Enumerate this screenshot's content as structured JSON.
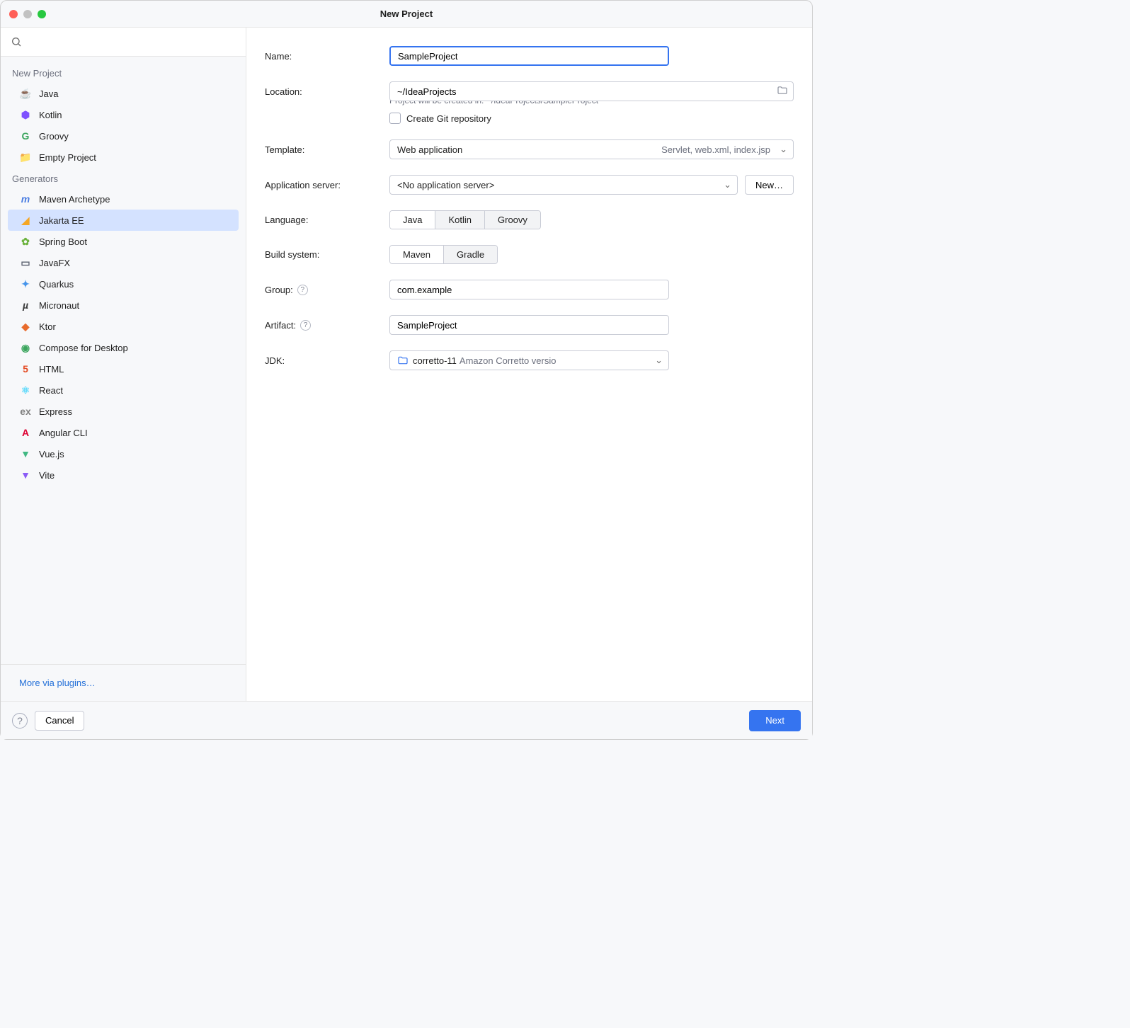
{
  "window": {
    "title": "New Project"
  },
  "sidebar": {
    "sections": [
      {
        "label": "New Project",
        "items": [
          {
            "label": "Java",
            "icon": "☕",
            "icon_name": "java-icon",
            "color": "#c27f3a"
          },
          {
            "label": "Kotlin",
            "icon": "⬢",
            "icon_name": "kotlin-icon",
            "color": "#7f52ff"
          },
          {
            "label": "Groovy",
            "icon": "G",
            "icon_name": "groovy-icon",
            "color": "#3ba55d"
          },
          {
            "label": "Empty Project",
            "icon": "📁",
            "icon_name": "folder-icon",
            "color": "#6e9fef"
          }
        ]
      },
      {
        "label": "Generators",
        "items": [
          {
            "label": "Maven Archetype",
            "icon": "m",
            "icon_name": "maven-icon",
            "color": "#4a7de2",
            "italic": true
          },
          {
            "label": "Jakarta EE",
            "icon": "◢",
            "icon_name": "jakarta-icon",
            "color": "#f5a623",
            "selected": true
          },
          {
            "label": "Spring Boot",
            "icon": "✿",
            "icon_name": "spring-icon",
            "color": "#6db33f"
          },
          {
            "label": "JavaFX",
            "icon": "▭",
            "icon_name": "javafx-icon",
            "color": "#5a5f6e"
          },
          {
            "label": "Quarkus",
            "icon": "✦",
            "icon_name": "quarkus-icon",
            "color": "#4695eb"
          },
          {
            "label": "Micronaut",
            "icon": "µ",
            "icon_name": "micronaut-icon",
            "color": "#3c3c3c",
            "italic": true
          },
          {
            "label": "Ktor",
            "icon": "◆",
            "icon_name": "ktor-icon",
            "color": "#e86b2c"
          },
          {
            "label": "Compose for Desktop",
            "icon": "◉",
            "icon_name": "compose-icon",
            "color": "#3ba55d"
          },
          {
            "label": "HTML",
            "icon": "5",
            "icon_name": "html5-icon",
            "color": "#e44d26"
          },
          {
            "label": "React",
            "icon": "⚛",
            "icon_name": "react-icon",
            "color": "#61dafb"
          },
          {
            "label": "Express",
            "icon": "ex",
            "icon_name": "express-icon",
            "color": "#808080"
          },
          {
            "label": "Angular CLI",
            "icon": "A",
            "icon_name": "angular-icon",
            "color": "#dd0031"
          },
          {
            "label": "Vue.js",
            "icon": "▼",
            "icon_name": "vue-icon",
            "color": "#41b883"
          },
          {
            "label": "Vite",
            "icon": "▼",
            "icon_name": "vite-icon",
            "color": "#8b5cf6"
          }
        ]
      }
    ],
    "more_link": "More via plugins…"
  },
  "form": {
    "name_label": "Name:",
    "name_value": "SampleProject",
    "location_label": "Location:",
    "location_value": "~/IdeaProjects",
    "location_hint": "Project will be created in: ~/IdeaProjects/SampleProject",
    "git_label": "Create Git repository",
    "template_label": "Template:",
    "template_value": "Web application",
    "template_secondary": "Servlet, web.xml, index.jsp",
    "appserver_label": "Application server:",
    "appserver_value": "<No application server>",
    "appserver_new": "New…",
    "language_label": "Language:",
    "language_options": [
      "Java",
      "Kotlin",
      "Groovy"
    ],
    "language_selected": "Java",
    "build_label": "Build system:",
    "build_options": [
      "Maven",
      "Gradle"
    ],
    "build_selected": "Maven",
    "group_label": "Group:",
    "group_value": "com.example",
    "artifact_label": "Artifact:",
    "artifact_value": "SampleProject",
    "jdk_label": "JDK:",
    "jdk_value": "corretto-11",
    "jdk_secondary": "Amazon Corretto versio"
  },
  "footer": {
    "cancel": "Cancel",
    "next": "Next"
  }
}
